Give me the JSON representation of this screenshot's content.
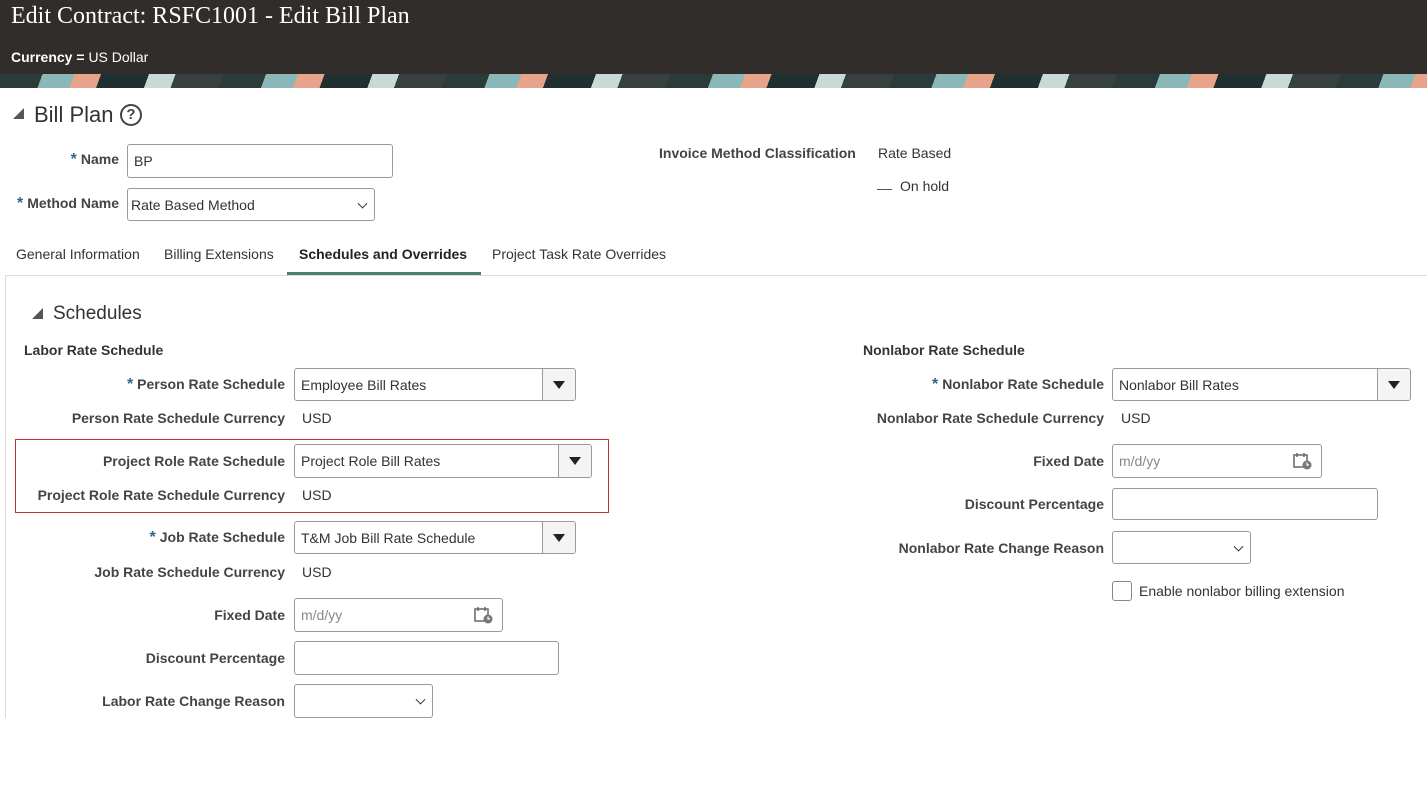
{
  "header": {
    "title": "Edit Contract: RSFC1001 - Edit Bill Plan",
    "currency_label": "Currency =",
    "currency_value": "US Dollar"
  },
  "bill_plan": {
    "title": "Bill Plan",
    "help_symbol": "?",
    "name_label": "Name",
    "name_value": "BP",
    "method_label": "Method Name",
    "method_value": "Rate Based Method",
    "invoice_method_label": "Invoice Method Classification",
    "invoice_method_value": "Rate Based",
    "on_hold_label": "On hold"
  },
  "tabs": [
    {
      "label": "General Information",
      "active": false
    },
    {
      "label": "Billing Extensions",
      "active": false
    },
    {
      "label": "Schedules and Overrides",
      "active": true
    },
    {
      "label": "Project Task Rate Overrides",
      "active": false
    }
  ],
  "schedules": {
    "title": "Schedules",
    "labor": {
      "heading": "Labor Rate Schedule",
      "person_rate_label": "Person Rate Schedule",
      "person_rate_value": "Employee Bill Rates",
      "person_currency_label": "Person Rate Schedule Currency",
      "person_currency_value": "USD",
      "project_role_label": "Project Role Rate Schedule",
      "project_role_value": "Project Role Bill Rates",
      "project_role_currency_label": "Project Role Rate Schedule Currency",
      "project_role_currency_value": "USD",
      "job_rate_label": "Job Rate Schedule",
      "job_rate_value": "T&M Job Bill Rate Schedule",
      "job_currency_label": "Job Rate Schedule Currency",
      "job_currency_value": "USD",
      "fixed_date_label": "Fixed Date",
      "fixed_date_placeholder": "m/d/yy",
      "discount_label": "Discount Percentage",
      "discount_value": "",
      "change_reason_label": "Labor Rate Change Reason",
      "change_reason_value": ""
    },
    "nonlabor": {
      "heading": "Nonlabor Rate Schedule",
      "rate_label": "Nonlabor Rate Schedule",
      "rate_value": "Nonlabor Bill Rates",
      "currency_label": "Nonlabor Rate Schedule Currency",
      "currency_value": "USD",
      "fixed_date_label": "Fixed Date",
      "fixed_date_placeholder": "m/d/yy",
      "discount_label": "Discount Percentage",
      "discount_value": "",
      "change_reason_label": "Nonlabor Rate Change Reason",
      "change_reason_value": "",
      "extension_label": "Enable nonlabor billing extension"
    }
  },
  "required_mark": "*"
}
